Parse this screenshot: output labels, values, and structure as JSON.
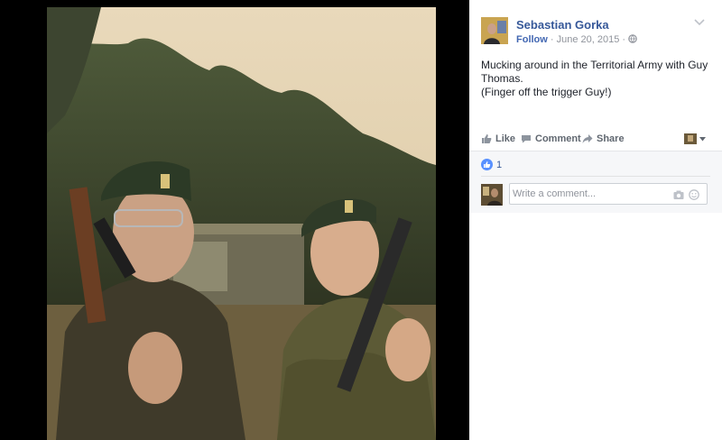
{
  "post": {
    "author": "Sebastian Gorka",
    "follow_label": "Follow",
    "separator": " · ",
    "date": "June 20, 2015",
    "separator2": " · ",
    "text_lines": [
      "Mucking around in the Territorial Army with Guy",
      "Thomas.",
      "(Finger off the trigger Guy!)"
    ]
  },
  "actions": {
    "like": "Like",
    "comment": "Comment",
    "share": "Share"
  },
  "reactions": {
    "count": "1"
  },
  "comment_input": {
    "placeholder": "Write a comment..."
  },
  "icons": {
    "options": "chevron-down-icon",
    "privacy": "globe-icon",
    "like": "thumbs-up-icon",
    "comment": "comment-bubble-icon",
    "share": "share-arrow-icon",
    "camera": "camera-icon",
    "emoji": "smiley-icon"
  },
  "colors": {
    "link": "#365899",
    "follow": "#4267b2",
    "like_badge": "#5890ff",
    "meta": "#90949c"
  }
}
